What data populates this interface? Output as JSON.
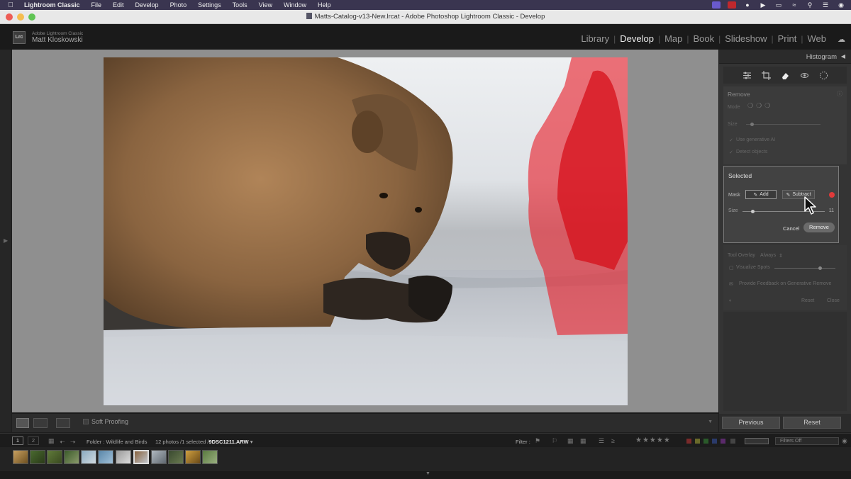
{
  "menubar": {
    "apple": "",
    "items": [
      "Lightroom Classic",
      "File",
      "Edit",
      "Develop",
      "Photo",
      "Settings",
      "Tools",
      "View",
      "Window",
      "Help"
    ]
  },
  "window": {
    "title": "Matts-Catalog-v13-New.lrcat - Adobe Photoshop Lightroom Classic - Develop"
  },
  "header": {
    "logo": "Lrc",
    "product": "Adobe Lightroom Classic",
    "user": "Matt Kloskowski",
    "modules": [
      "Library",
      "Develop",
      "Map",
      "Book",
      "Slideshow",
      "Print",
      "Web"
    ],
    "active_module": "Develop"
  },
  "right_panel": {
    "histogram_label": "Histogram",
    "remove": {
      "heading": "Remove",
      "mode_label": "Mode",
      "size_label": "Size",
      "use_gen_ai": "Use generative AI",
      "detect_objects": "Detect objects"
    },
    "selected": {
      "heading": "Selected",
      "mask_label": "Mask",
      "add_label": "Add",
      "subtract_label": "Subtract",
      "size_label": "Size",
      "size_value": "11",
      "size_fraction": 0.12,
      "cancel_label": "Cancel",
      "remove_label": "Remove"
    },
    "lower": {
      "tool_overlay_label": "Tool Overlay",
      "tool_overlay_value": "Always",
      "visualize_spots": "Visualize Spots",
      "provide_feedback": "Provide Feedback on Generative Remove",
      "reset": "Reset",
      "close": "Close"
    },
    "previous_label": "Previous",
    "reset_label": "Reset"
  },
  "toolbar": {
    "soft_proofing": "Soft Proofing"
  },
  "filmstrip_bar": {
    "page1": "1",
    "page2": "2",
    "folder": "Folder : Wildlife and Birds",
    "count": "12 photos /1 selected /",
    "filename": "9DSC1211.ARW",
    "filter_label": "Filter :",
    "filters_off": "Filters Off",
    "stars": "★★★★★"
  },
  "colors": {
    "mask_red": "#e8212b",
    "accent_dot": "#e03a3a"
  }
}
